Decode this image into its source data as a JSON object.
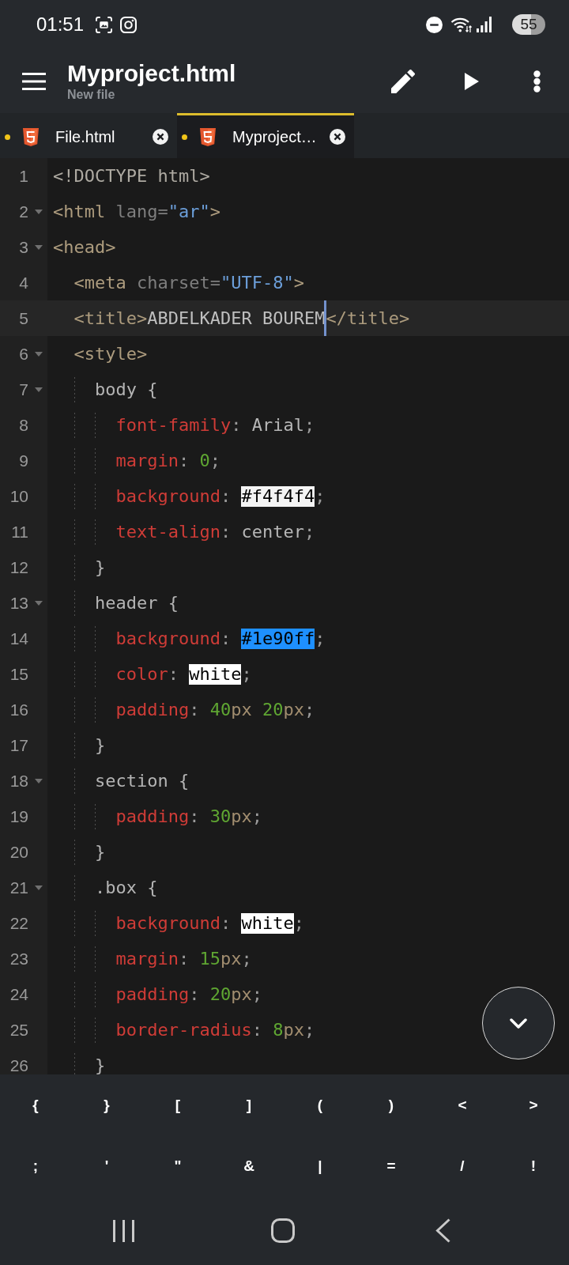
{
  "status_bar": {
    "time": "01:51",
    "battery": "55"
  },
  "toolbar": {
    "title": "Myproject.html",
    "subtitle": "New file"
  },
  "tabs": [
    {
      "label": "File.html",
      "selected": false,
      "modified": true
    },
    {
      "label": "Myproject…",
      "selected": true,
      "modified": true
    }
  ],
  "editor": {
    "lines": [
      {
        "number": "1",
        "foldable": false,
        "current": false,
        "tokens": [
          {
            "kind": "doctype",
            "text": "<!DOCTYPE html>"
          }
        ]
      },
      {
        "number": "2",
        "foldable": true,
        "current": false,
        "tokens": [
          {
            "kind": "tag",
            "text": "<html"
          },
          {
            "kind": "attr",
            "text": " lang="
          },
          {
            "kind": "string",
            "text": "\"ar\""
          },
          {
            "kind": "tag",
            "text": ">"
          }
        ]
      },
      {
        "number": "3",
        "foldable": true,
        "current": false,
        "tokens": [
          {
            "kind": "tag",
            "text": "<head>"
          }
        ]
      },
      {
        "number": "4",
        "foldable": false,
        "current": false,
        "tokens": [
          {
            "kind": "tag",
            "text": "  <meta"
          },
          {
            "kind": "attr",
            "text": " charset="
          },
          {
            "kind": "string",
            "text": "\"UTF-8\""
          },
          {
            "kind": "tag",
            "text": ">"
          }
        ]
      },
      {
        "number": "5",
        "foldable": false,
        "current": true,
        "tokens": [
          {
            "kind": "tag",
            "text": "  <title>"
          },
          {
            "kind": "text",
            "text": "ABDELKADER BOUREM"
          },
          {
            "kind": "cursor"
          },
          {
            "kind": "tag",
            "text": "</title>"
          }
        ]
      },
      {
        "number": "6",
        "foldable": true,
        "current": false,
        "tokens": [
          {
            "kind": "tag",
            "text": "  <style>"
          }
        ]
      },
      {
        "number": "7",
        "foldable": true,
        "current": false,
        "tokens": [
          {
            "kind": "selector",
            "text": "    body {"
          }
        ]
      },
      {
        "number": "8",
        "foldable": false,
        "current": false,
        "tokens": [
          {
            "kind": "property",
            "text": "      font-family"
          },
          {
            "kind": "punct",
            "text": ": "
          },
          {
            "kind": "value",
            "text": "Arial"
          },
          {
            "kind": "punct",
            "text": ";"
          }
        ]
      },
      {
        "number": "9",
        "foldable": false,
        "current": false,
        "tokens": [
          {
            "kind": "property",
            "text": "      margin"
          },
          {
            "kind": "punct",
            "text": ": "
          },
          {
            "kind": "number",
            "text": "0"
          },
          {
            "kind": "punct",
            "text": ";"
          }
        ]
      },
      {
        "number": "10",
        "foldable": false,
        "current": false,
        "tokens": [
          {
            "kind": "property",
            "text": "      background"
          },
          {
            "kind": "punct",
            "text": ": "
          },
          {
            "kind": "color",
            "text": "#f4f4f4",
            "color": "#f4f4f4"
          },
          {
            "kind": "punct",
            "text": ";"
          }
        ]
      },
      {
        "number": "11",
        "foldable": false,
        "current": false,
        "tokens": [
          {
            "kind": "property",
            "text": "      text-align"
          },
          {
            "kind": "punct",
            "text": ": "
          },
          {
            "kind": "value",
            "text": "center"
          },
          {
            "kind": "punct",
            "text": ";"
          }
        ]
      },
      {
        "number": "12",
        "foldable": false,
        "current": false,
        "tokens": [
          {
            "kind": "selector",
            "text": "    }"
          }
        ]
      },
      {
        "number": "13",
        "foldable": true,
        "current": false,
        "tokens": [
          {
            "kind": "selector",
            "text": "    header {"
          }
        ]
      },
      {
        "number": "14",
        "foldable": false,
        "current": false,
        "tokens": [
          {
            "kind": "property",
            "text": "      background"
          },
          {
            "kind": "punct",
            "text": ": "
          },
          {
            "kind": "color",
            "text": "#1e90ff",
            "color": "#1e90ff"
          },
          {
            "kind": "punct",
            "text": ";"
          }
        ]
      },
      {
        "number": "15",
        "foldable": false,
        "current": false,
        "tokens": [
          {
            "kind": "property",
            "text": "      color"
          },
          {
            "kind": "punct",
            "text": ": "
          },
          {
            "kind": "color",
            "text": "white",
            "color": "#ffffff"
          },
          {
            "kind": "punct",
            "text": ";"
          }
        ]
      },
      {
        "number": "16",
        "foldable": false,
        "current": false,
        "tokens": [
          {
            "kind": "property",
            "text": "      padding"
          },
          {
            "kind": "punct",
            "text": ": "
          },
          {
            "kind": "number",
            "text": "40"
          },
          {
            "kind": "unit",
            "text": "px "
          },
          {
            "kind": "number",
            "text": "20"
          },
          {
            "kind": "unit",
            "text": "px"
          },
          {
            "kind": "punct",
            "text": ";"
          }
        ]
      },
      {
        "number": "17",
        "foldable": false,
        "current": false,
        "tokens": [
          {
            "kind": "selector",
            "text": "    }"
          }
        ]
      },
      {
        "number": "18",
        "foldable": true,
        "current": false,
        "tokens": [
          {
            "kind": "selector",
            "text": "    section {"
          }
        ]
      },
      {
        "number": "19",
        "foldable": false,
        "current": false,
        "tokens": [
          {
            "kind": "property",
            "text": "      padding"
          },
          {
            "kind": "punct",
            "text": ": "
          },
          {
            "kind": "number",
            "text": "30"
          },
          {
            "kind": "unit",
            "text": "px"
          },
          {
            "kind": "punct",
            "text": ";"
          }
        ]
      },
      {
        "number": "20",
        "foldable": false,
        "current": false,
        "tokens": [
          {
            "kind": "selector",
            "text": "    }"
          }
        ]
      },
      {
        "number": "21",
        "foldable": true,
        "current": false,
        "tokens": [
          {
            "kind": "selector",
            "text": "    .box {"
          }
        ]
      },
      {
        "number": "22",
        "foldable": false,
        "current": false,
        "tokens": [
          {
            "kind": "property",
            "text": "      background"
          },
          {
            "kind": "punct",
            "text": ": "
          },
          {
            "kind": "color",
            "text": "white",
            "color": "#ffffff"
          },
          {
            "kind": "punct",
            "text": ";"
          }
        ]
      },
      {
        "number": "23",
        "foldable": false,
        "current": false,
        "tokens": [
          {
            "kind": "property",
            "text": "      margin"
          },
          {
            "kind": "punct",
            "text": ": "
          },
          {
            "kind": "number",
            "text": "15"
          },
          {
            "kind": "unit",
            "text": "px"
          },
          {
            "kind": "punct",
            "text": ";"
          }
        ]
      },
      {
        "number": "24",
        "foldable": false,
        "current": false,
        "tokens": [
          {
            "kind": "property",
            "text": "      padding"
          },
          {
            "kind": "punct",
            "text": ": "
          },
          {
            "kind": "number",
            "text": "20"
          },
          {
            "kind": "unit",
            "text": "px"
          },
          {
            "kind": "punct",
            "text": ";"
          }
        ]
      },
      {
        "number": "25",
        "foldable": false,
        "current": false,
        "tokens": [
          {
            "kind": "property",
            "text": "      border-radius"
          },
          {
            "kind": "punct",
            "text": ": "
          },
          {
            "kind": "number",
            "text": "8"
          },
          {
            "kind": "unit",
            "text": "px"
          },
          {
            "kind": "punct",
            "text": ";"
          }
        ]
      },
      {
        "number": "26",
        "foldable": false,
        "current": false,
        "tokens": [
          {
            "kind": "selector",
            "text": "    }"
          }
        ]
      }
    ]
  },
  "keyboard_bar": {
    "rows": [
      {
        "keys": [
          "{",
          "}",
          "[",
          "]",
          "(",
          ")",
          "<",
          ">"
        ]
      },
      {
        "keys": [
          ";",
          "'",
          "\"",
          "&",
          "|",
          "=",
          "/",
          "!"
        ]
      }
    ]
  }
}
